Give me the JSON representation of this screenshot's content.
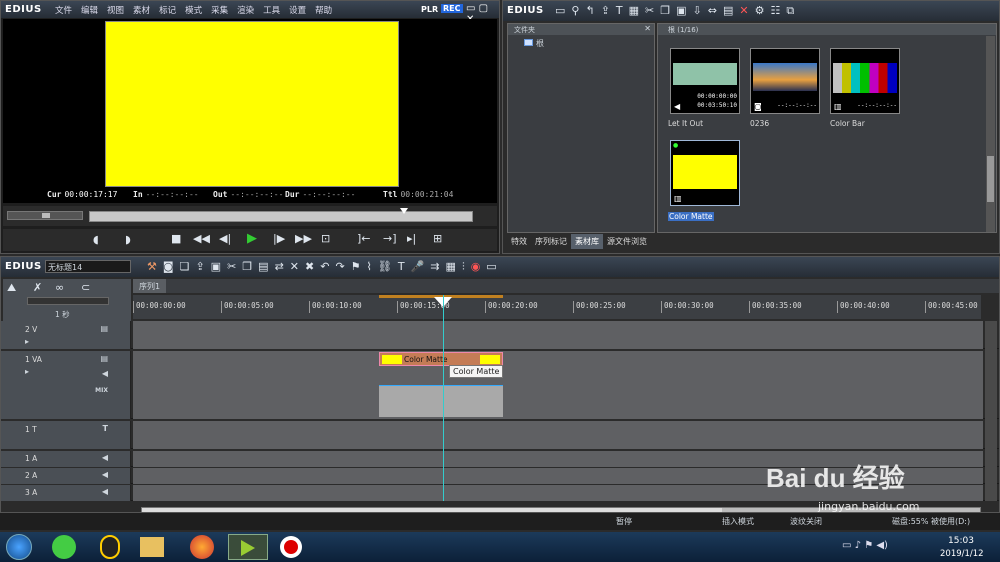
{
  "player": {
    "logo": "EDIUS",
    "menu": [
      "文件",
      "编辑",
      "视图",
      "素材",
      "标记",
      "模式",
      "采集",
      "渲染",
      "工具",
      "设置",
      "帮助"
    ],
    "plr": "PLR",
    "rec": "REC",
    "tc": [
      {
        "label": "Cur",
        "value": "00:00:17:17"
      },
      {
        "label": "In",
        "value": "--:--:--:--"
      },
      {
        "label": "Out",
        "value": "--:--:--:--"
      },
      {
        "label": "Dur",
        "value": "--:--:--:--"
      },
      {
        "label": "Ttl",
        "value": "00:00:21:04"
      }
    ],
    "screen_color": "#ffff00"
  },
  "bin": {
    "logo": "EDIUS",
    "folder_title": "文件夹",
    "root": "根",
    "path": "根 (1/16)",
    "clips": [
      {
        "name": "Let It Out",
        "tc1": "00:00:00:00",
        "tc2": "00:03:50:10"
      },
      {
        "name": "0236",
        "tc1": "",
        "tc2": "--:--:--:--"
      },
      {
        "name": "Color Bar",
        "tc1": "",
        "tc2": "--:--:--:--"
      },
      {
        "name": "Color Matte",
        "tc1": "",
        "tc2": ""
      }
    ],
    "tabs": [
      "特效",
      "序列标记",
      "素材库",
      "源文件浏览"
    ],
    "active_tab": 2
  },
  "timeline": {
    "logo": "EDIUS",
    "project": "无标题14",
    "sequence_tab": "序列1",
    "scale": "1 秒",
    "ruler": [
      "00:00:00:00",
      "00:00:05:00",
      "00:00:10:00",
      "00:00:15:00",
      "00:00:20:00",
      "00:00:25:00",
      "00:00:30:00",
      "00:00:35:00",
      "00:00:40:00",
      "00:00:45:00"
    ],
    "tracks": [
      {
        "name": "2 V"
      },
      {
        "name": "1 VA"
      },
      {
        "name": "1 T"
      },
      {
        "name": "1 A"
      },
      {
        "name": "2 A"
      },
      {
        "name": "3 A"
      }
    ],
    "mix": "MIX",
    "clip_label": "Color Matte",
    "tooltip": "Color Matte"
  },
  "status": {
    "pause": "暂停",
    "insert": "插入模式",
    "ripple": "波纹关闭",
    "disk": "磁盘:55% 被使用(D:)"
  },
  "taskbar": {
    "time": "15:03",
    "date": "2019/1/12"
  },
  "watermark": {
    "text": "Bai du 经验",
    "url": "jingyan.baidu.com"
  }
}
